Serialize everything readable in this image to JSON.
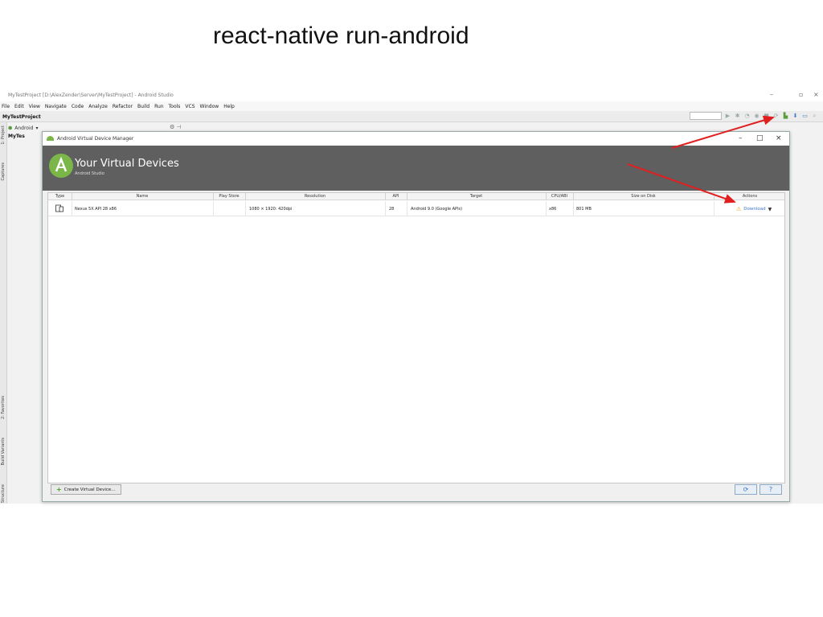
{
  "slide": {
    "title": "react-native run-android"
  },
  "ide": {
    "window_title": "MyTestProject [D:\\AlexZender\\Server\\MyTestProject] - Android Studio",
    "menu": [
      "File",
      "Edit",
      "View",
      "Navigate",
      "Code",
      "Analyze",
      "Refactor",
      "Build",
      "Run",
      "Tools",
      "VCS",
      "Window",
      "Help"
    ],
    "project_name": "MyTestProject",
    "project_view": "Android",
    "project_root": "MyTes",
    "left_tabs": [
      "1: Project",
      "Captures",
      "2: Favorites",
      "Build Variants",
      "Structure"
    ],
    "avd_manager_color": "#5a9e3c"
  },
  "dialog": {
    "title": "Android Virtual Device Manager",
    "header_title": "Your Virtual Devices",
    "header_subtitle": "Android Studio",
    "columns": [
      "Type",
      "Name",
      "Play Store",
      "Resolution",
      "API",
      "Target",
      "CPU/ABI",
      "Size on Disk",
      "Actions"
    ],
    "rows": [
      {
        "type_icon": "phone-tablet-icon",
        "name": "Nexus 5X API 28 x86",
        "play_store": "",
        "resolution": "1080 × 1920: 420dpi",
        "api": "28",
        "target": "Android 9.0 (Google APIs)",
        "cpu_abi": "x86",
        "size_on_disk": "801 MB",
        "action": "Download"
      }
    ],
    "create_button": "Create Virtual Device...",
    "refresh_icon": "refresh-icon",
    "help_label": "?"
  },
  "annotation": {
    "arrow_color": "#e02020"
  }
}
